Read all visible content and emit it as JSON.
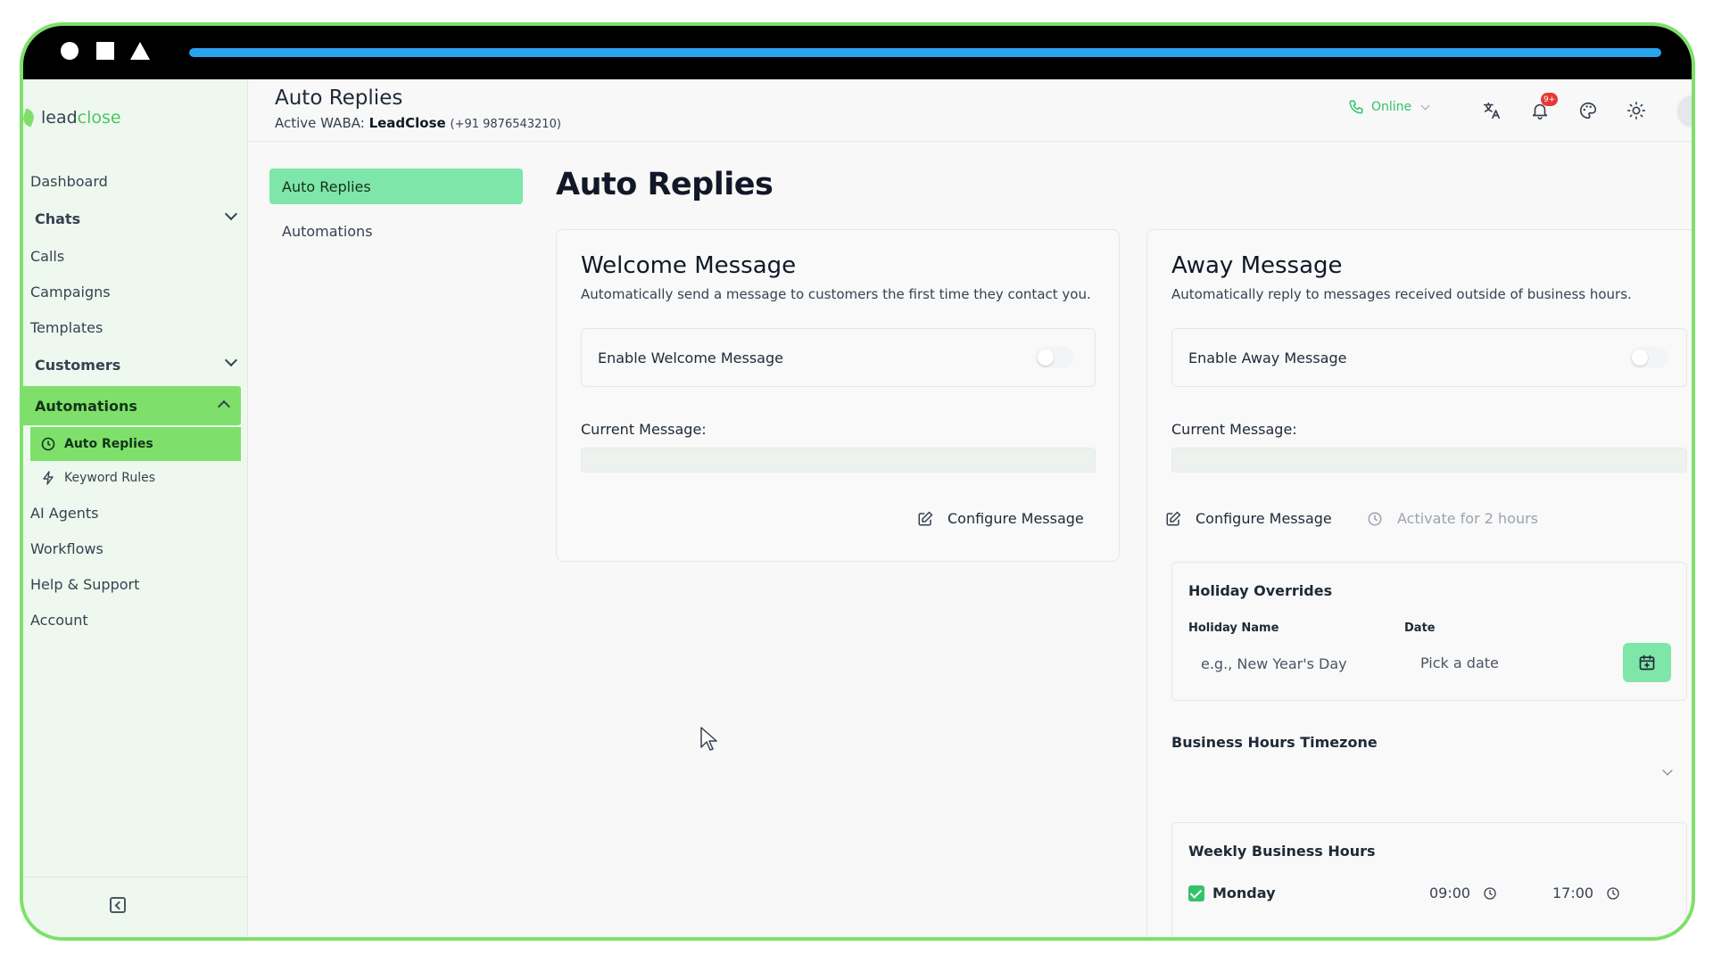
{
  "window": {
    "loading_progress": 1.0
  },
  "brand": {
    "logo_part1": "lead",
    "logo_part2": "close",
    "accent": "#7ee06a"
  },
  "sidebar": {
    "items": [
      {
        "label": "Dashboard"
      },
      {
        "label": "Chats"
      },
      {
        "label": "Calls"
      },
      {
        "label": "Campaigns"
      },
      {
        "label": "Templates"
      },
      {
        "label": "Customers"
      },
      {
        "label": "Automations"
      },
      {
        "label": "Auto Replies"
      },
      {
        "label": "Keyword Rules"
      },
      {
        "label": "AI Agents"
      },
      {
        "label": "Workflows"
      },
      {
        "label": "Help & Support"
      },
      {
        "label": "Account"
      }
    ]
  },
  "header": {
    "title": "Auto Replies",
    "waba_prefix": "Active WABA:",
    "waba_name": "LeadClose",
    "waba_phone": "(+91 9876543210)",
    "status": "Online",
    "notification_badge": "9+"
  },
  "subnav": {
    "items": [
      {
        "label": "Auto Replies"
      },
      {
        "label": "Automations"
      }
    ]
  },
  "main": {
    "title": "Auto Replies",
    "welcome": {
      "title": "Welcome Message",
      "desc": "Automatically send a message to customers the first time they contact you.",
      "toggle_label": "Enable Welcome Message",
      "current_label": "Current Message:",
      "configure_label": "Configure Message"
    },
    "away": {
      "title": "Away Message",
      "desc": "Automatically reply to messages received outside of business hours.",
      "toggle_label": "Enable Away Message",
      "current_label": "Current Message:",
      "configure_label": "Configure Message",
      "activate_label": "Activate for 2 hours",
      "holiday": {
        "title": "Holiday Overrides",
        "name_label": "Holiday Name",
        "date_label": "Date",
        "name_placeholder": "e.g., New Year's Day",
        "date_placeholder": "Pick a date"
      },
      "timezone_label": "Business Hours Timezone",
      "weekly": {
        "title": "Weekly Business Hours",
        "days": [
          {
            "day": "Monday",
            "open": "09:00",
            "close": "17:00",
            "enabled": true
          }
        ]
      }
    }
  }
}
